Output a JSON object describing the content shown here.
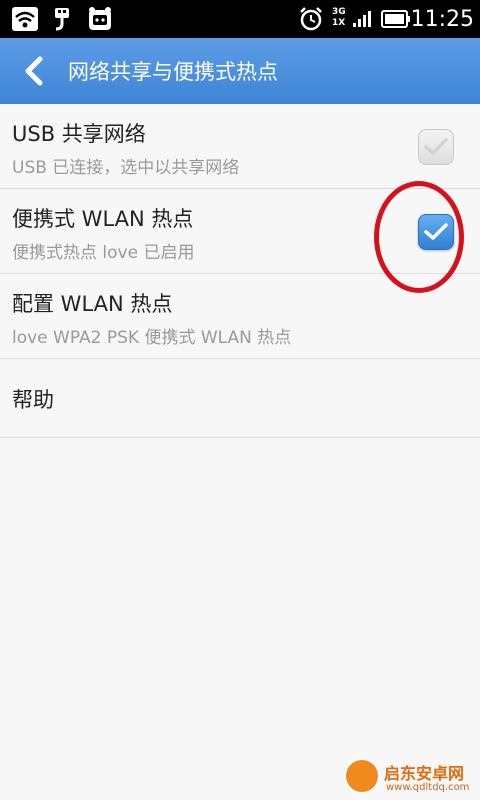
{
  "status_bar": {
    "time": "11:25",
    "network_top": "3G",
    "network_bottom": "1X",
    "icons": [
      "wifi-hotspot-icon",
      "usb-icon",
      "notification-app-icon",
      "alarm-icon",
      "signal-icon",
      "battery-icon"
    ]
  },
  "action_bar": {
    "title": "网络共享与便携式热点",
    "back_icon": "chevron-left-icon",
    "color": "#4a8fdd"
  },
  "settings": [
    {
      "title": "USB 共享网络",
      "subtitle": "USB 已连接，选中以共享网络",
      "checkbox": "unchecked-disabled"
    },
    {
      "title": "便携式 WLAN 热点",
      "subtitle": "便携式热点 love 已启用",
      "checkbox": "checked"
    },
    {
      "title": "配置 WLAN 热点",
      "subtitle": "love WPA2 PSK 便携式 WLAN 热点"
    },
    {
      "title": "帮助"
    }
  ],
  "annotation": {
    "color": "#d8101c",
    "shape": "ellipse"
  },
  "watermark": {
    "title": "启东安卓网",
    "url": "www.qdltdq.com"
  }
}
